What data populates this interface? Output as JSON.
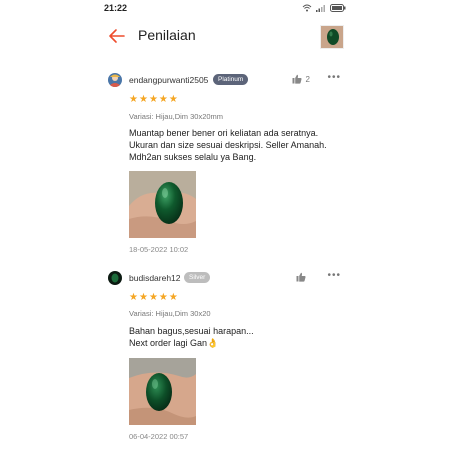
{
  "status_bar": {
    "time": "21:22",
    "wifi_icon": "wifi-icon",
    "signal_icon": "signal-icon",
    "battery_icon": "battery-icon"
  },
  "header": {
    "title": "Penilaian",
    "back_icon": "arrow-left-icon",
    "product_thumb": "green-stone-thumbnail"
  },
  "colors": {
    "accent": "#ee4d2d",
    "star": "#f5a623",
    "platinum_badge": "#5c6479",
    "silver_badge": "#bdbdbd"
  },
  "reviews": [
    {
      "username": "endangpurwanti2505",
      "badge": "Platinum",
      "like_count": "2",
      "rating": 5,
      "variant": "Variasi: Hijau,Dim 30x20mm",
      "text": "Muantap bener bener ori keliatan ada seratnya.\nUkuran dan size sesuai deskripsi. Seller Amanah.\nMdh2an sukses selalu ya Bang.",
      "date": "18-05-2022 10:02"
    },
    {
      "username": "budisdareh12",
      "badge": "Silver",
      "like_count": "",
      "rating": 5,
      "variant": "Variasi: Hijau,Dim 30x20",
      "text": "Bahan bagus,sesuai harapan...\nNext order lagi Gan👌",
      "date": "06-04-2022 00:57"
    }
  ]
}
